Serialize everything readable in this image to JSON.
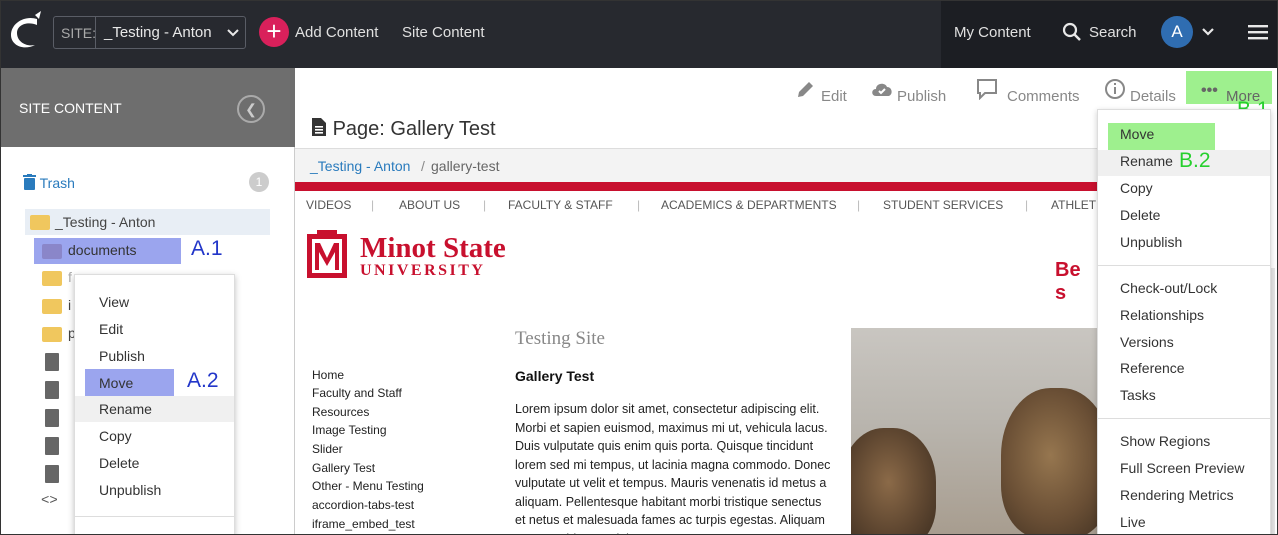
{
  "topbar": {
    "site_label": "SITE:",
    "site_value": "_Testing - Anton",
    "add_content": "Add Content",
    "site_content": "Site Content",
    "my_content": "My Content",
    "search": "Search",
    "avatar_initial": "A"
  },
  "sidebar": {
    "title": "SITE CONTENT",
    "trash": "Trash",
    "trash_count": "1",
    "root": "_Testing - Anton",
    "selected": "documents"
  },
  "context_menu": {
    "items": [
      "View",
      "Edit",
      "Publish",
      "Move",
      "Rename",
      "Copy",
      "Delete",
      "Unpublish"
    ]
  },
  "annotations": {
    "a1": "A.1",
    "a2": "A.2",
    "b1": "B.1",
    "b2": "B.2"
  },
  "actions": {
    "edit": "Edit",
    "publish": "Publish",
    "comments": "Comments",
    "details": "Details",
    "more": "More"
  },
  "page": {
    "title": "Page: Gallery Test",
    "breadcrumb_site": "_Testing - Anton",
    "breadcrumb_sep": "/",
    "breadcrumb_page": "gallery-test"
  },
  "preview": {
    "nav": [
      "VIDEOS",
      "ABOUT US",
      "FACULTY & STAFF",
      "ACADEMICS & DEPARTMENTS",
      "STUDENT SERVICES",
      "ATHLET"
    ],
    "logo_line1": "Minot State",
    "logo_line2": "UNIVERSITY",
    "be_so": "Be s",
    "site_heading": "Testing Site",
    "content_heading": "Gallery Test",
    "body": "Lorem ipsum dolor sit amet, consectetur adipiscing elit. Morbi et sapien euismod, maximus mi ut, vehicula lacus. Duis vulputate quis enim quis porta. Quisque tincidunt lorem sed mi tempus, ut lacinia magna commodo. Donec vulputate ut velit et tempus. Mauris venenatis id metus a aliquam. Pellentesque habitant morbi tristique senectus et netus et malesuada fames ac turpis egestas. Aliquam ac purus id ex sagittis",
    "left_nav": [
      "Home",
      "Faculty and Staff",
      "Resources",
      "Image Testing",
      "Slider",
      "Gallery Test",
      "Other - Menu Testing",
      "accordion-tabs-test",
      "iframe_embed_test"
    ]
  },
  "more_menu": {
    "items": [
      "Move",
      "Rename",
      "Copy",
      "Delete",
      "Unpublish",
      "Check-out/Lock",
      "Relationships",
      "Versions",
      "Reference",
      "Tasks",
      "Show Regions",
      "Full Screen Preview",
      "Rendering Metrics",
      "Live"
    ]
  }
}
